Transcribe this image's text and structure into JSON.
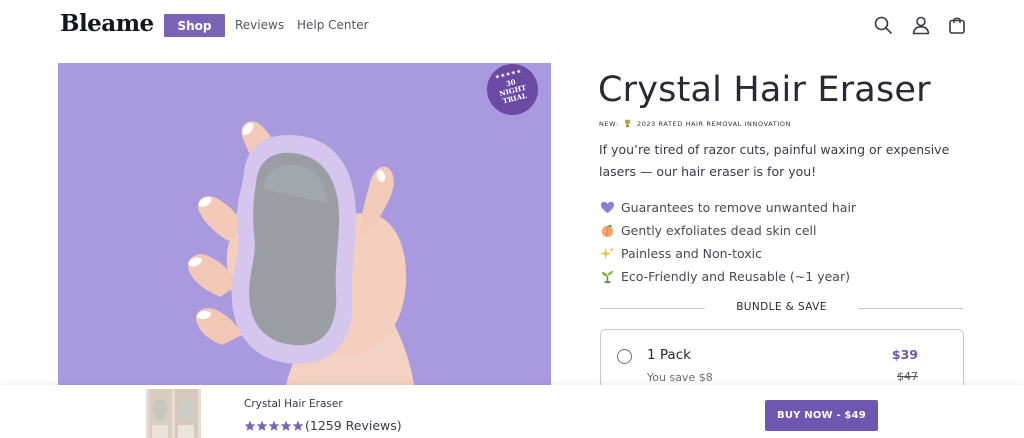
{
  "header": {
    "logo": "Bleame",
    "nav": [
      {
        "label": "Shop",
        "active": true
      },
      {
        "label": "Reviews"
      },
      {
        "label": "Help Center"
      }
    ],
    "icons": [
      "search-icon",
      "account-icon",
      "cart-icon"
    ]
  },
  "hero": {
    "badge_text": "30 NIGHT TRIAL",
    "badge_stars": "★★★★★",
    "background_color": "#a99ae0"
  },
  "product": {
    "title": "Crystal Hair Eraser",
    "tagline_prefix": "NEW:",
    "tagline_icon": "trophy-icon",
    "tagline": "2023 RATED HAIR REMOVAL INNOVATION",
    "lead": "If you’re tired of razor cuts, painful waxing or expensive lasers — our hair eraser is for you!",
    "benefits": [
      {
        "icon": "purple-heart-icon",
        "text": "Guarantees to remove unwanted hair"
      },
      {
        "icon": "peach-icon",
        "text": "Gently exfoliates dead skin cell"
      },
      {
        "icon": "sparkles-icon",
        "text": "Painless and Non-toxic"
      },
      {
        "icon": "seedling-icon",
        "text": "Eco-Friendly and Reusable (~1 year)"
      }
    ],
    "bundle_label": "BUNDLE & SAVE",
    "options": [
      {
        "name": "1 Pack",
        "savings": "You save $8",
        "price": "$39",
        "original_price": "$47",
        "selected": false
      }
    ]
  },
  "sticky_bar": {
    "title": "Crystal Hair Eraser",
    "rating_stars": 5,
    "reviews": "(1259 Reviews)",
    "buy_button": "BUY NOW -  $49"
  },
  "colors": {
    "accent": "#7a64b8",
    "button": "#6d57b0",
    "text": "#2a2933"
  }
}
